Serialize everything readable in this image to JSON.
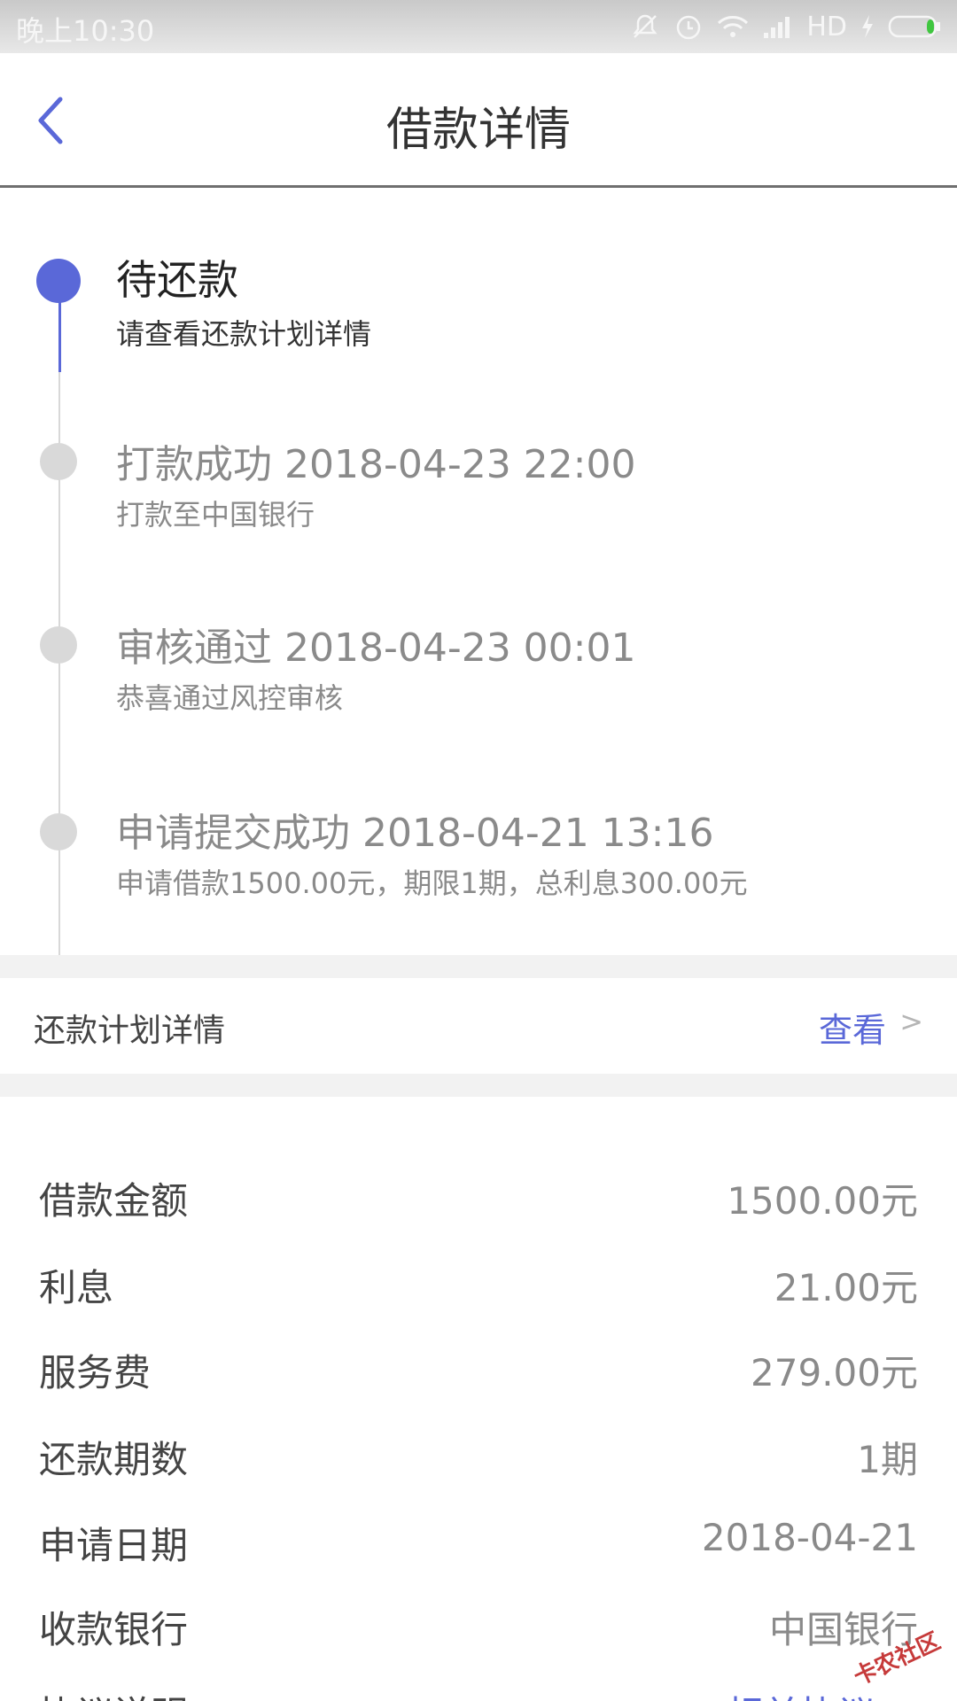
{
  "status_bar": {
    "time": "晚上10:30",
    "network": "HD",
    "battery_color": "#3fc63f"
  },
  "header": {
    "title": "借款详情",
    "back_icon": "chevron-left-icon",
    "accent": "#5a68d8"
  },
  "timeline": [
    {
      "title": "待还款",
      "subtitle": "请查看还款计划详情",
      "active": true
    },
    {
      "title": "打款成功 2018-04-23 22:00",
      "subtitle": "打款至中国银行",
      "active": false
    },
    {
      "title": "审核通过 2018-04-23 00:01",
      "subtitle": "恭喜通过风控审核",
      "active": false
    },
    {
      "title": "申请提交成功 2018-04-21 13:16",
      "subtitle": "申请借款1500.00元，期限1期，总利息300.00元",
      "active": false
    }
  ],
  "plan": {
    "label": "还款计划详情",
    "link": "查看",
    "chevron": ">"
  },
  "details": [
    {
      "label": "借款金额",
      "value": "1500.00元"
    },
    {
      "label": "利息",
      "value": "21.00元"
    },
    {
      "label": "服务费",
      "value": "279.00元"
    },
    {
      "label": "还款期数",
      "value": "1期"
    },
    {
      "label": "申请日期",
      "value": "2018-04-21"
    },
    {
      "label": "收款银行",
      "value": "中国银行"
    },
    {
      "label": "协议说明",
      "value": "相关协议 >"
    }
  ],
  "watermark": "卡农社区"
}
